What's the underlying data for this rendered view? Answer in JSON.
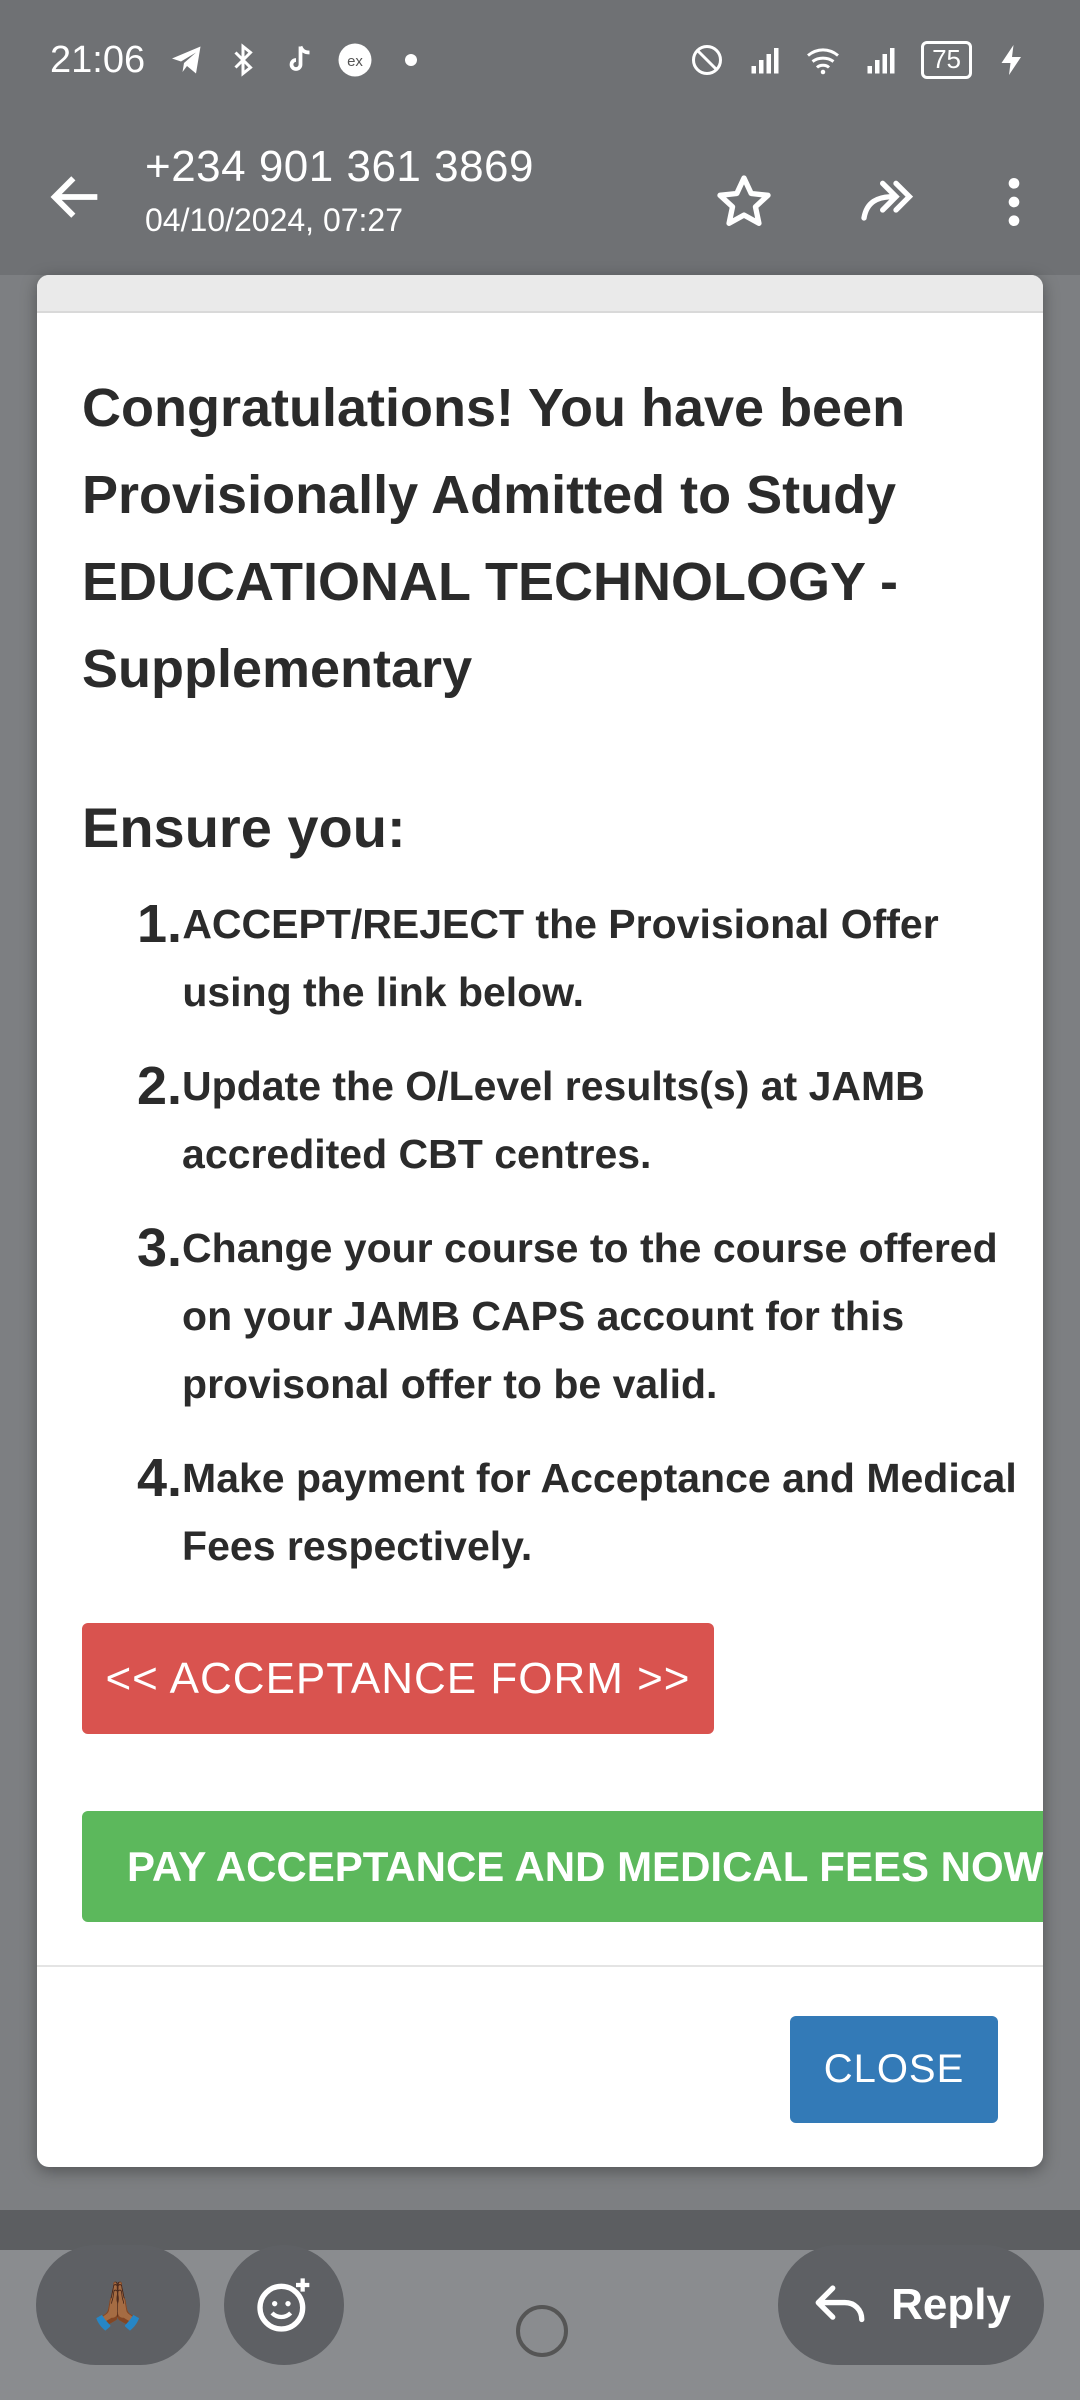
{
  "status_bar": {
    "time": "21:06",
    "battery": "75"
  },
  "header": {
    "sender": "+234 901 361 3869",
    "date": "04/10/2024, 07:27"
  },
  "dialog": {
    "headline": "Congratulations! You have been Provisionally Admitted to Study EDUCATIONAL TECHNOLOGY - Supplementary",
    "ensure_label": "Ensure you:",
    "steps": [
      {
        "num": "1.",
        "text": "ACCEPT/REJECT the Provisional Offer using the link below."
      },
      {
        "num": "2.",
        "text": "Update the O/Level results(s) at JAMB accredited CBT centres."
      },
      {
        "num": "3.",
        "text": "Change your course to the course offered on your JAMB CAPS account for this provisonal offer to be valid."
      },
      {
        "num": "4.",
        "text": "Make payment for Acceptance and Medical Fees respectively."
      }
    ],
    "acceptance_button": "<< ACCEPTANCE FORM >>",
    "pay_button": "PAY ACCEPTANCE AND MEDICAL FEES NOW >>",
    "close_button": "CLOSE"
  },
  "bottom_bar": {
    "react_emoji": "🙏🏾",
    "reply_label": "Reply"
  },
  "colors": {
    "accept": "#d9534f",
    "pay": "#5cb85c",
    "close": "#337ab7"
  }
}
